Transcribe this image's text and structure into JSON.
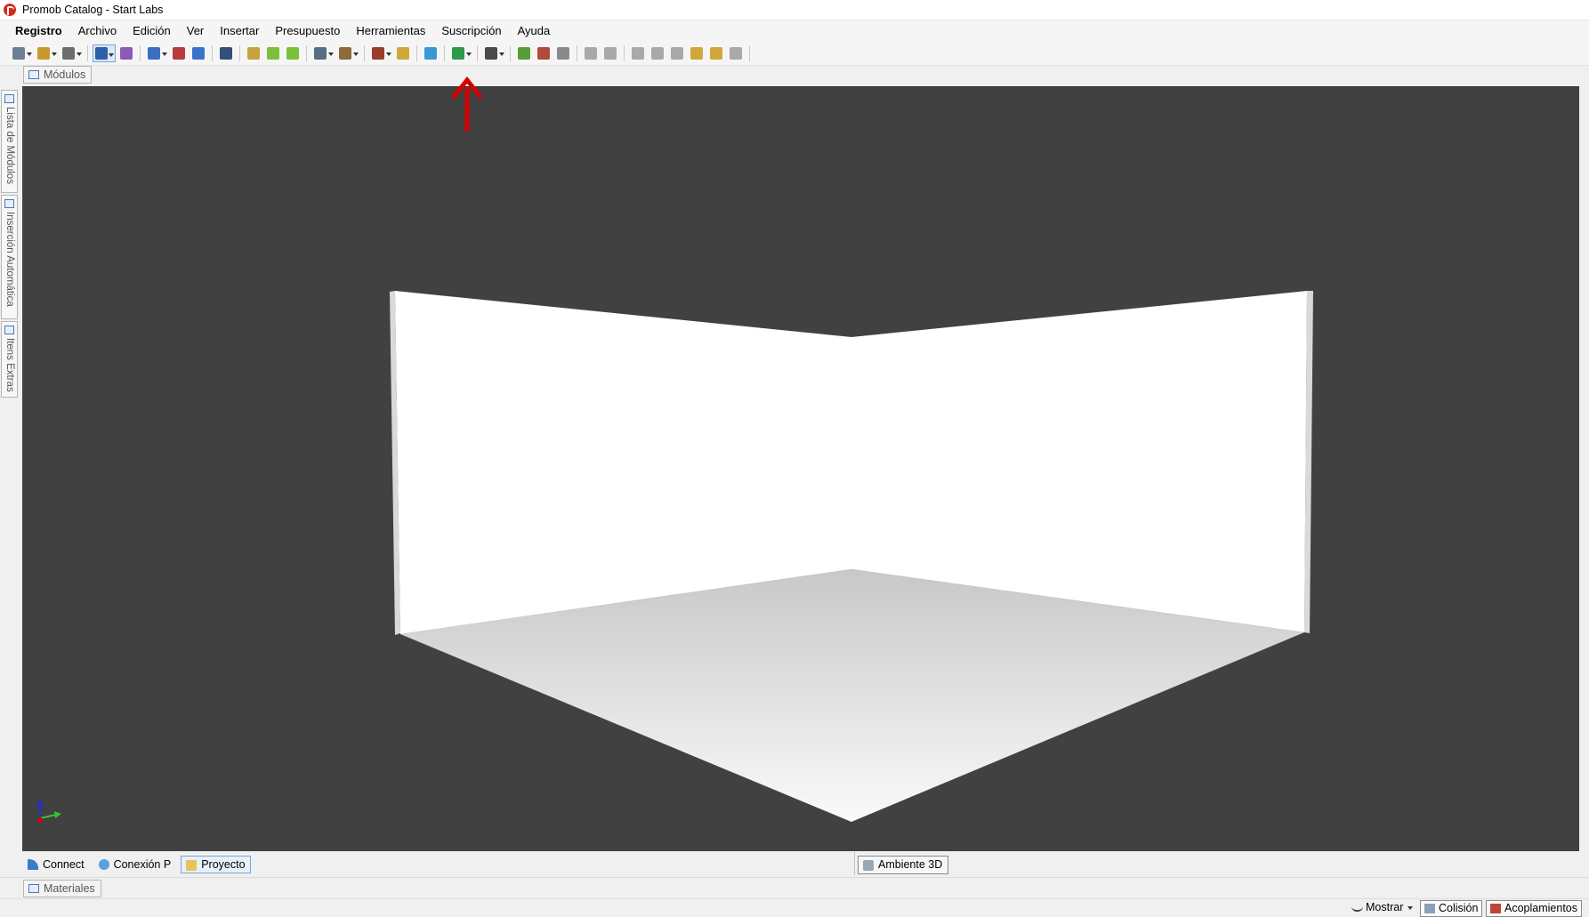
{
  "window": {
    "title": "Promob Catalog - Start Labs"
  },
  "menu": [
    "Registro",
    "Archivo",
    "Edición",
    "Ver",
    "Insertar",
    "Presupuesto",
    "Herramientas",
    "Suscripción",
    "Ayuda"
  ],
  "toolbar_icons": [
    {
      "name": "new-project-icon",
      "color": "#6d7f96",
      "dropdown": true
    },
    {
      "name": "modules-tree-icon",
      "color": "#c79a2a",
      "dropdown": true
    },
    {
      "name": "shape-icon",
      "color": "#6d6d6d",
      "dropdown": true
    },
    {
      "sep": true
    },
    {
      "name": "select-pointer-icon",
      "color": "#2e5fa8",
      "dropdown": true,
      "selected": true
    },
    {
      "name": "measure-icon",
      "color": "#8a5bb8",
      "dropdown": false
    },
    {
      "sep": true
    },
    {
      "name": "layers-icon",
      "color": "#3b6fc2",
      "dropdown": true
    },
    {
      "name": "book-icon",
      "color": "#b83a3a",
      "dropdown": false
    },
    {
      "name": "view-3d-icon",
      "color": "#3a74c9",
      "dropdown": false
    },
    {
      "sep": true
    },
    {
      "name": "eye-icon",
      "color": "#334f7a",
      "dropdown": false
    },
    {
      "sep": true
    },
    {
      "name": "import-icon",
      "color": "#c7a240",
      "dropdown": false
    },
    {
      "name": "back-arrow-icon",
      "color": "#7cbf3a",
      "dropdown": false
    },
    {
      "name": "forward-arrow-icon",
      "color": "#7cbf3a",
      "dropdown": false
    },
    {
      "sep": true
    },
    {
      "name": "window-layout-icon",
      "color": "#5a6d86",
      "dropdown": true
    },
    {
      "name": "box-icon",
      "color": "#8b6b3a",
      "dropdown": true
    },
    {
      "sep": true
    },
    {
      "name": "render-icon",
      "color": "#9b3c2c",
      "dropdown": true
    },
    {
      "name": "lamp-icon",
      "color": "#d1a63a",
      "dropdown": false
    },
    {
      "sep": true
    },
    {
      "name": "chat-icon",
      "color": "#3a97d6",
      "dropdown": false
    },
    {
      "sep": true
    },
    {
      "name": "budget-icon",
      "color": "#2c9a4b",
      "dropdown": true
    },
    {
      "sep": true
    },
    {
      "name": "save-icon",
      "color": "#4a4a4a",
      "dropdown": true
    },
    {
      "sep": true
    },
    {
      "name": "cloud-upload-icon",
      "color": "#5a9b3a",
      "dropdown": false
    },
    {
      "name": "cloud-delete-icon",
      "color": "#b04a3a",
      "dropdown": false
    },
    {
      "name": "print-icon",
      "color": "#8a8a8a",
      "dropdown": false
    },
    {
      "sep": true
    },
    {
      "name": "undo-icon",
      "color": "#a9a9a9",
      "dropdown": false
    },
    {
      "name": "redo-icon",
      "color": "#a9a9a9",
      "dropdown": false
    },
    {
      "sep": true
    },
    {
      "name": "cut-icon",
      "color": "#a9a9a9",
      "dropdown": false
    },
    {
      "name": "copy-icon",
      "color": "#a9a9a9",
      "dropdown": false
    },
    {
      "name": "paste-icon",
      "color": "#a9a9a9",
      "dropdown": false
    },
    {
      "name": "hammer-icon",
      "color": "#d1a63a",
      "dropdown": false
    },
    {
      "name": "paint-roller-icon",
      "color": "#d1a63a",
      "dropdown": false
    },
    {
      "name": "delete-x-icon",
      "color": "#a9a9a9",
      "dropdown": false
    },
    {
      "sep": true
    }
  ],
  "top_panel_tab": "Módulos",
  "side_tabs": [
    "Lista de Módulos",
    "Inserción Automática",
    "Itens Extras"
  ],
  "bottom_tabs": [
    {
      "label": "Connect",
      "active": false
    },
    {
      "label": "Conexión P",
      "active": false
    },
    {
      "label": "Proyecto",
      "active": true
    }
  ],
  "view_tab": "Ambiente 3D",
  "materials_tab": "Materiales",
  "status": {
    "show": "Mostrar",
    "collision": "Colisión",
    "dockings": "Acoplamientos"
  },
  "colors": {
    "viewport_bg": "#414141",
    "accent": "#d40000"
  }
}
